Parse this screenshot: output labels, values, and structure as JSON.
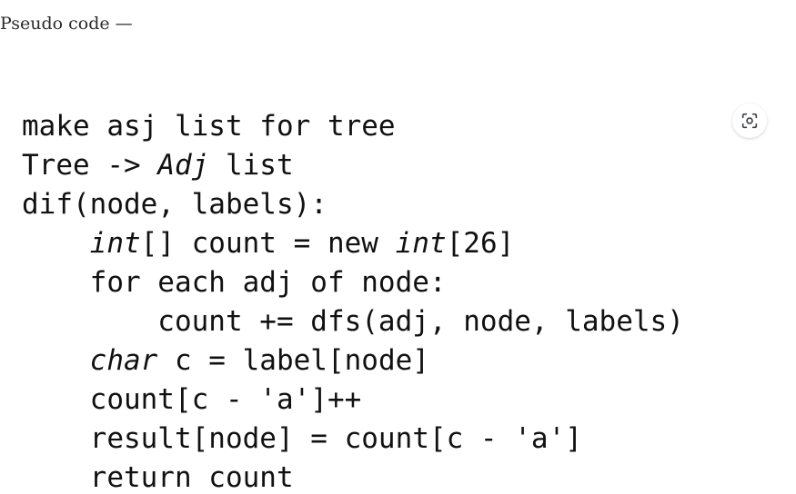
{
  "intro": {
    "text": "Pseudo code —"
  },
  "code": {
    "lines": [
      [
        {
          "t": "make asj list for tree"
        }
      ],
      [
        {
          "t": "Tree -> "
        },
        {
          "t": "Adj",
          "i": true
        },
        {
          "t": " list"
        }
      ],
      [
        {
          "t": "dif(node, labels):"
        }
      ],
      [
        {
          "t": "    "
        },
        {
          "t": "int",
          "i": true
        },
        {
          "t": "[] count = new "
        },
        {
          "t": "int",
          "i": true
        },
        {
          "t": "[26]"
        }
      ],
      [
        {
          "t": "    for each adj of node:"
        }
      ],
      [
        {
          "t": "        count += dfs(adj, node, labels)"
        }
      ],
      [
        {
          "t": "    "
        },
        {
          "t": "char",
          "i": true
        },
        {
          "t": " c = label[node]"
        }
      ],
      [
        {
          "t": "    count[c - 'a']++"
        }
      ],
      [
        {
          "t": "    result[node] = count[c - 'a']"
        }
      ],
      [
        {
          "t": "    return count"
        }
      ]
    ]
  },
  "icons": {
    "scan": "text-scan-icon"
  },
  "colors": {
    "icon": "#3c4043"
  }
}
